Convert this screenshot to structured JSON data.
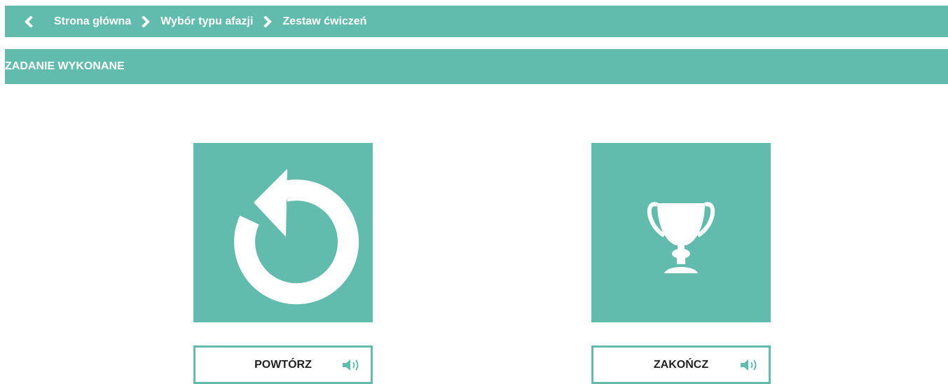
{
  "breadcrumb": {
    "items": [
      {
        "label": "Strona główna"
      },
      {
        "label": "Wybór typu afazji"
      },
      {
        "label": "Zestaw ćwiczeń"
      }
    ]
  },
  "header": {
    "title": "ZADANIE WYKONANE"
  },
  "actions": {
    "repeat_label": "POWTÓRZ",
    "finish_label": "ZAKOŃCZ"
  },
  "colors": {
    "accent": "#62bcad",
    "background": "#ffffff",
    "label_text": "#222222"
  },
  "icons": {
    "back": "chevron-left-icon",
    "separator": "chevron-right-icon",
    "repeat": "refresh-icon",
    "finish": "trophy-icon",
    "audio": "speaker-icon"
  }
}
